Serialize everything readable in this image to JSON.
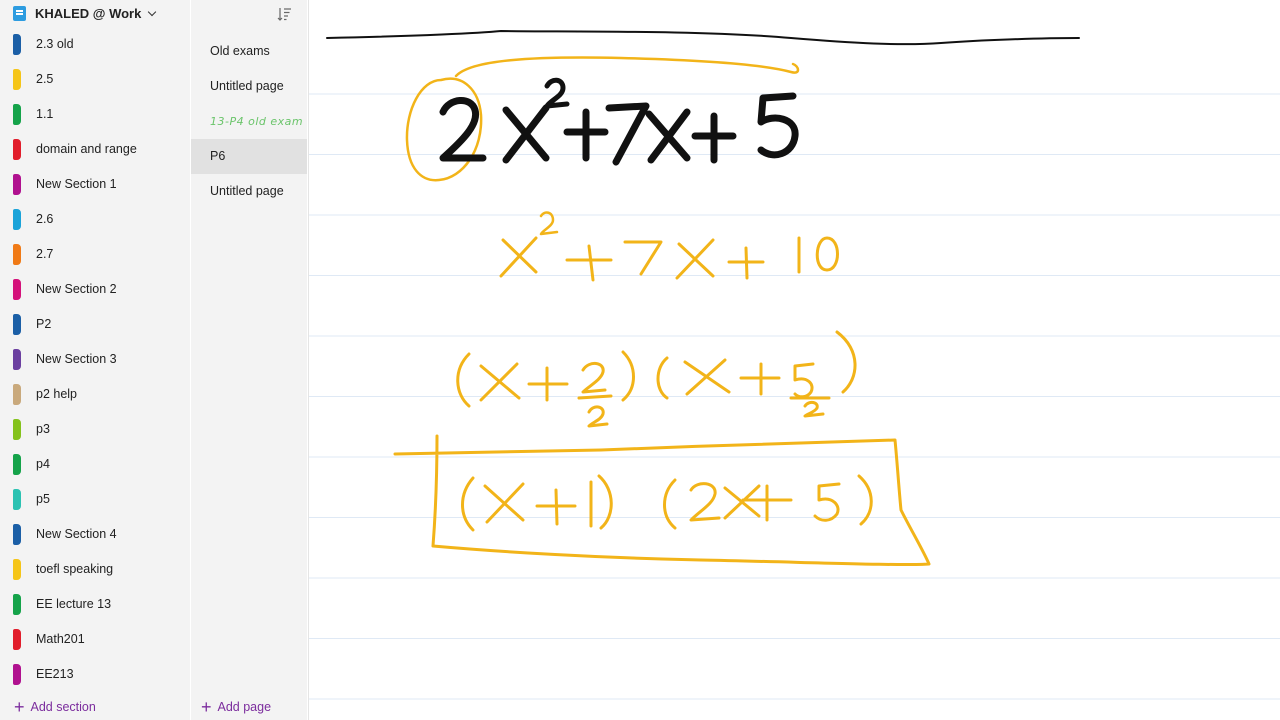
{
  "notebook": {
    "title": "KHALED @ Work",
    "icon": "onenote-notebook-icon"
  },
  "sections": [
    {
      "label": "2.3 old",
      "color": "#1b5fa6"
    },
    {
      "label": "2.5",
      "color": "#f5c518"
    },
    {
      "label": "1.1",
      "color": "#15a34a"
    },
    {
      "label": "domain and range",
      "color": "#e11d2b"
    },
    {
      "label": "New Section 1",
      "color": "#b0118f"
    },
    {
      "label": "2.6",
      "color": "#1aa3d9"
    },
    {
      "label": "2.7",
      "color": "#f07a16"
    },
    {
      "label": "New Section 2",
      "color": "#d4117a"
    },
    {
      "label": "P2",
      "color": "#1b5fa6"
    },
    {
      "label": "New Section 3",
      "color": "#6b3fa0"
    },
    {
      "label": "p2 help",
      "color": "#c9a97c"
    },
    {
      "label": "p3",
      "color": "#84c21b"
    },
    {
      "label": "p4",
      "color": "#15a34a"
    },
    {
      "label": "p5",
      "color": "#2bc2b2"
    },
    {
      "label": "New Section 4",
      "color": "#1b5fa6"
    },
    {
      "label": "toefl speaking",
      "color": "#f5c518"
    },
    {
      "label": "EE lecture 13",
      "color": "#15a34a"
    },
    {
      "label": "Math201",
      "color": "#e11d2b"
    },
    {
      "label": "EE213",
      "color": "#b0118f"
    }
  ],
  "pages": [
    {
      "label": "Old exams",
      "selected": false,
      "ink": false
    },
    {
      "label": "Untitled page",
      "selected": false,
      "ink": false
    },
    {
      "label": "13-P4 old exam",
      "selected": false,
      "ink": true
    },
    {
      "label": "P6",
      "selected": true,
      "ink": false
    },
    {
      "label": "Untitled page",
      "selected": false,
      "ink": false
    }
  ],
  "footer": {
    "add_section": "Add section",
    "add_page": "Add page"
  },
  "colors": {
    "accent": "#7b2c9d",
    "ink_black": "#111111",
    "ink_yellow": "#f2b419",
    "rule_line": "#dfe9f5"
  }
}
